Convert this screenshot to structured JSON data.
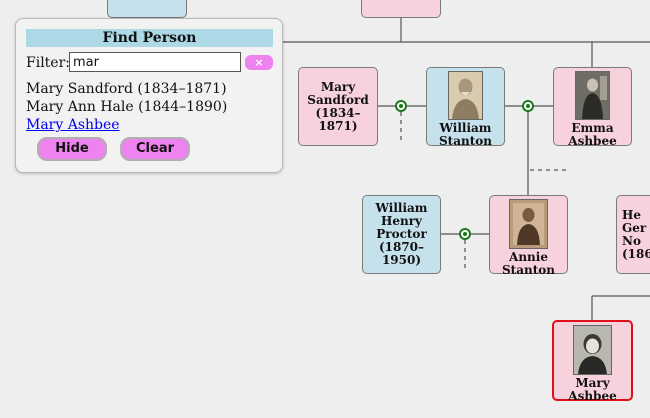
{
  "finder": {
    "title": "Find Person",
    "filter_label": "Filter:",
    "filter_value": "mar",
    "clear_x": "×",
    "results": [
      "Mary Sandford (1834–1871)",
      "Mary Ann Hale (1844–1890)",
      "Mary Ashbee"
    ],
    "hide_label": "Hide",
    "clear_label": "Clear"
  },
  "people": {
    "mary_sandford": "Mary Sandford (1834–1871)",
    "william_stanton": "William Stanton",
    "emma_ashbee": "Emma Ashbee",
    "william_henry_proctor": "William Henry Proctor (1870–1950)",
    "annie_stanton": "Annie Stanton",
    "partial_right": "He Ger No (186",
    "mary_ashbee": "Mary Ashbee"
  },
  "colors": {
    "female": "#f7d2dc",
    "male": "#c5e1ec",
    "selected_border": "#e0101a",
    "knot": "#1a7a1a",
    "button": "#ee82ee",
    "panel_title": "#add8e6"
  }
}
